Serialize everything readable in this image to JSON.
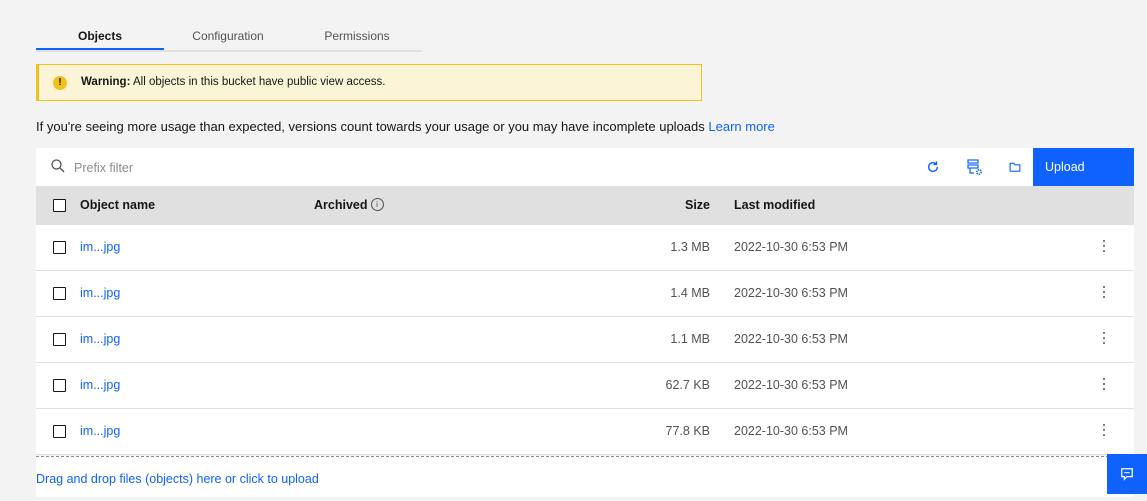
{
  "tabs": [
    {
      "label": "Objects"
    },
    {
      "label": "Configuration"
    },
    {
      "label": "Permissions"
    }
  ],
  "warning": {
    "title": "Warning:",
    "text": "All objects in this bucket have public view access.",
    "icon": "warning-icon",
    "color": "#f1c21b"
  },
  "info": {
    "text": "If you're seeing more usage than expected, versions count towards your usage or you may have incomplete uploads",
    "link": "Learn more"
  },
  "toolbar": {
    "search_placeholder": "Prefix filter",
    "icons": [
      "refresh-icon",
      "configure-icon",
      "folder-icon"
    ],
    "upload_label": "Upload"
  },
  "table": {
    "headers": {
      "name": "Object name",
      "archived": "Archived",
      "size": "Size",
      "modified": "Last modified"
    },
    "rows": [
      {
        "name": "im...jpg",
        "size": "1.3 MB",
        "modified": "2022-10-30 6:53 PM"
      },
      {
        "name": "im...jpg",
        "size": "1.4 MB",
        "modified": "2022-10-30 6:53 PM"
      },
      {
        "name": "im...jpg",
        "size": "1.1 MB",
        "modified": "2022-10-30 6:53 PM"
      },
      {
        "name": "im...jpg",
        "size": "62.7 KB",
        "modified": "2022-10-30 6:53 PM"
      },
      {
        "name": "im...jpg",
        "size": "77.8 KB",
        "modified": "2022-10-30 6:53 PM"
      }
    ]
  },
  "dropzone": {
    "text": "Drag and drop files (objects) here or click to upload"
  },
  "colors": {
    "accent": "#0f62fe",
    "background": "#f3f3f3",
    "header": "#e0e0e0"
  }
}
